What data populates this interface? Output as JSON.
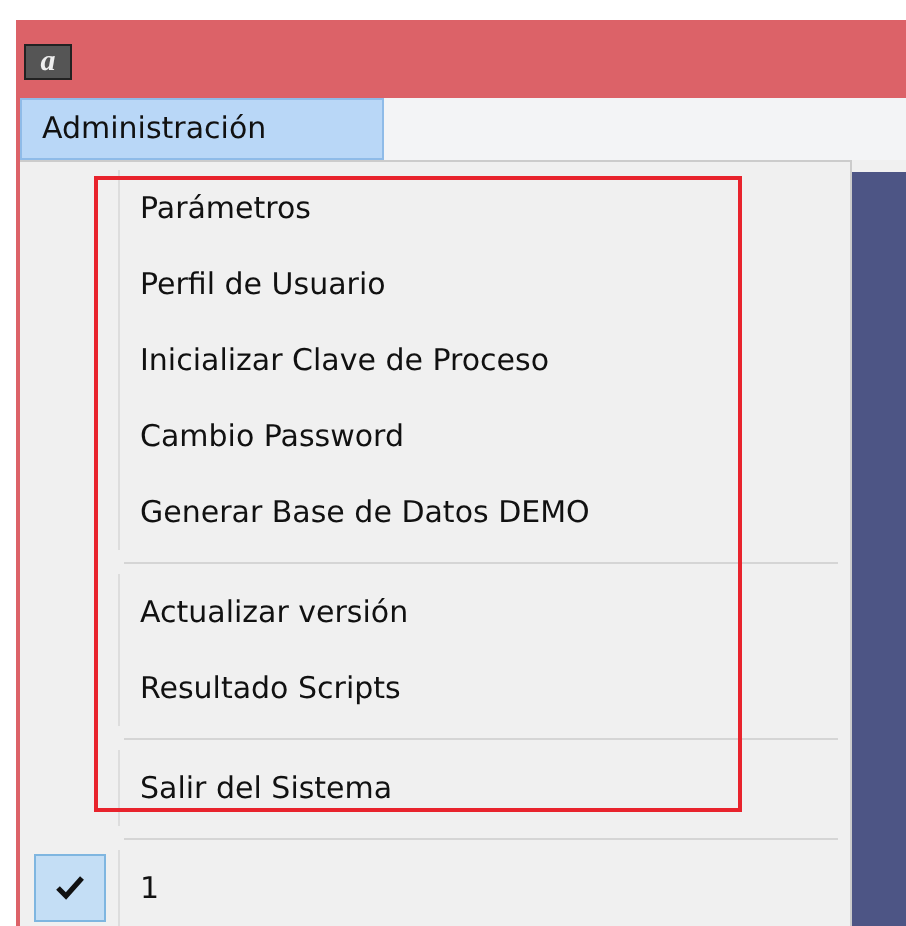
{
  "window": {
    "icon": "a"
  },
  "menu_bar": [
    {
      "label": "Administración",
      "selected": true
    }
  ],
  "menu": [
    {
      "kind": "item",
      "label": "Parámetros",
      "checked": false
    },
    {
      "kind": "item",
      "label": "Perfil de Usuario",
      "checked": false
    },
    {
      "kind": "item",
      "label": "Inicializar Clave de Proceso",
      "checked": false
    },
    {
      "kind": "item",
      "label": "Cambio Password",
      "checked": false
    },
    {
      "kind": "item",
      "label": "Generar Base de Datos DEMO",
      "checked": false
    },
    {
      "kind": "separator"
    },
    {
      "kind": "item",
      "label": "Actualizar versión",
      "checked": false
    },
    {
      "kind": "item",
      "label": "Resultado Scripts",
      "checked": false
    },
    {
      "kind": "separator"
    },
    {
      "kind": "item",
      "label": "Salir del Sistema",
      "checked": false
    },
    {
      "kind": "separator"
    },
    {
      "kind": "item",
      "label": "1",
      "checked": true
    }
  ]
}
